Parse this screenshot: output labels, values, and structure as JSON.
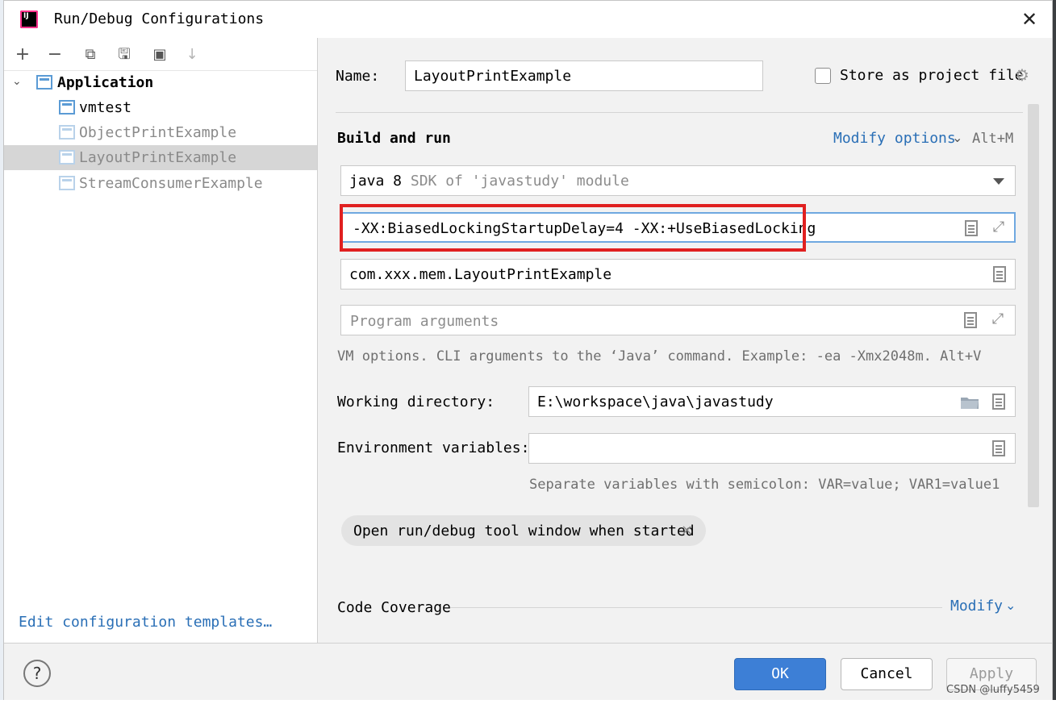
{
  "window": {
    "title": "Run/Debug Configurations",
    "app_icon_text": "IJ"
  },
  "toolbar": {
    "add": "+",
    "remove": "−",
    "copy": "⧉",
    "save": "🖫",
    "folder": "▣",
    "sort": "↓"
  },
  "tree": {
    "root": "Application",
    "items": [
      {
        "label": "vmtest"
      },
      {
        "label": "ObjectPrintExample"
      },
      {
        "label": "LayoutPrintExample"
      },
      {
        "label": "StreamConsumerExample"
      }
    ],
    "selected": "LayoutPrintExample"
  },
  "edit_templates_link": "Edit configuration templates…",
  "form": {
    "name_label": "Name:",
    "name_value": "LayoutPrintExample",
    "store_label": "Store as project file",
    "section_title": "Build and run",
    "modify_options": "Modify options",
    "modify_shortcut": "Alt+M",
    "jdk_main": "java 8",
    "jdk_hint": "SDK of 'javastudy' module",
    "vm_options": "-XX:BiasedLockingStartupDelay=4 -XX:+UseBiasedLocking",
    "main_class": "com.xxx.mem.LayoutPrintExample",
    "program_args_placeholder": "Program arguments",
    "vm_hint": "VM options. CLI arguments to the ‘Java’ command. Example: -ea -Xmx2048m. Alt+V",
    "working_dir_label": "Working directory:",
    "working_dir_value": "E:\\workspace\\java\\javastudy",
    "env_label": "Environment variables:",
    "env_value": "",
    "env_hint": "Separate variables with semicolon: VAR=value; VAR1=value1",
    "chip_label": "Open run/debug tool window when started",
    "code_coverage": "Code Coverage",
    "modify": "Modify"
  },
  "footer": {
    "help": "?",
    "ok": "OK",
    "cancel": "Cancel",
    "apply": "Apply"
  },
  "watermark": "CSDN @luffy5459",
  "colors": {
    "accent": "#3d7fd6",
    "link": "#2a6fb6",
    "highlight_box": "#e02020",
    "selected_row": "#d6d6d6"
  }
}
